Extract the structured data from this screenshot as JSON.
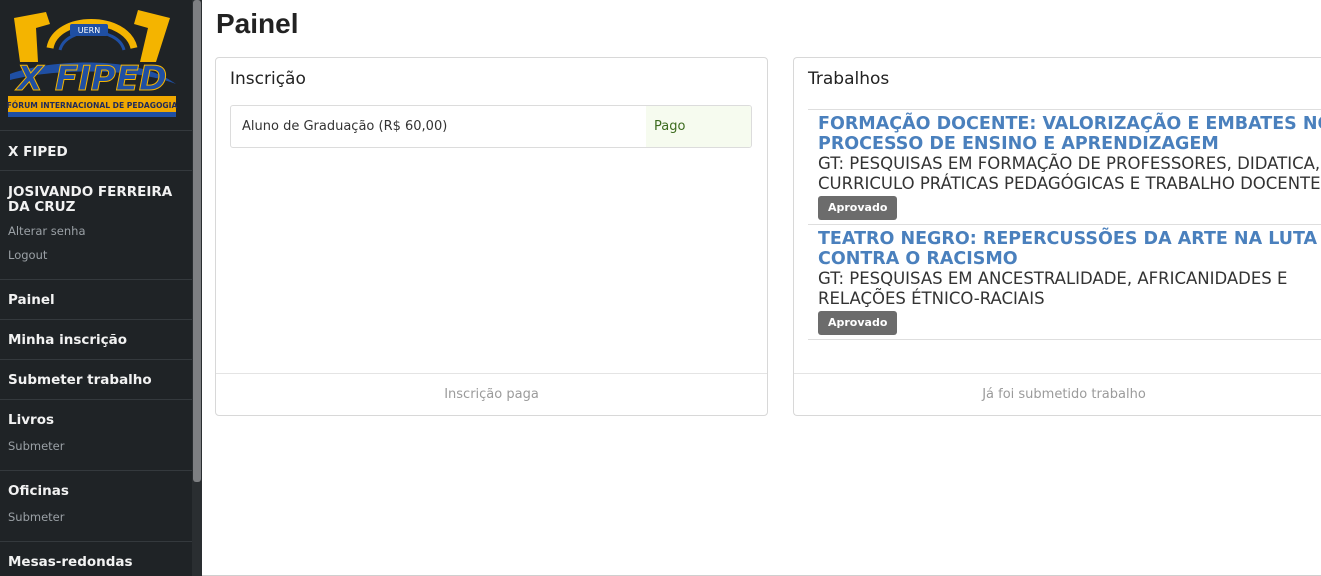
{
  "sidebar": {
    "logo": {
      "badge_text": "UERN",
      "wordmark": "X FIPED",
      "banner_text": "FÓRUM INTERNACIONAL DE PEDAGOGIA",
      "colors": {
        "gold": "#f4b400",
        "blue": "#1f4fa3",
        "banner": "#f0a800"
      }
    },
    "event_name": "X FIPED",
    "user": {
      "name": "JOSIVANDO FERREIRA DA CRUZ",
      "change_password": "Alterar senha",
      "logout": "Logout"
    },
    "nav": {
      "painel": "Painel",
      "minha_inscricao": "Minha inscrição",
      "submeter_trabalho": "Submeter trabalho",
      "livros": {
        "label": "Livros",
        "sub": "Submeter"
      },
      "oficinas": {
        "label": "Oficinas",
        "sub": "Submeter"
      },
      "mesas": "Mesas-redondas"
    }
  },
  "main": {
    "title": "Painel",
    "inscricao": {
      "heading": "Inscrição",
      "type": "Aluno de Graduação (R$ 60,00)",
      "status": "Pago",
      "footer": "Inscrição paga"
    },
    "trabalhos": {
      "heading": "Trabalhos",
      "items": [
        {
          "title": "FORMAÇÃO DOCENTE: VALORIZAÇÃO E EMBATES NO PROCESSO DE ENSINO E APRENDIZAGEM",
          "gt": "GT: PESQUISAS EM FORMAÇÃO DE PROFESSORES, DIDATICA, CURRICULO PRÁTICAS PEDAGÓGICAS E TRABALHO DOCENTE",
          "status": "Aprovado"
        },
        {
          "title": "TEATRO NEGRO: REPERCUSSÕES DA ARTE NA LUTA CONTRA O RACISMO",
          "gt": "GT: PESQUISAS EM ANCESTRALIDADE, AFRICANIDADES E RELAÇÕES ÉTNICO-RACIAIS",
          "status": "Aprovado"
        }
      ],
      "footer": "Já foi submetido trabalho"
    }
  }
}
